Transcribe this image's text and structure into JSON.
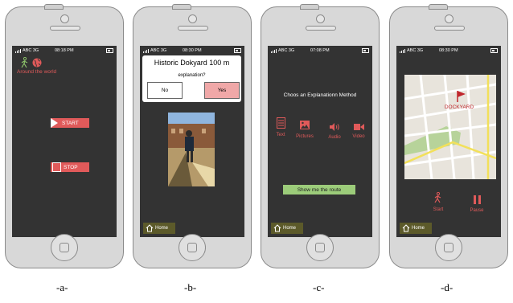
{
  "captions": [
    "-a-",
    "-b-",
    "-c-",
    "-d-"
  ],
  "status_bars": [
    {
      "carrier": "ABC 3G",
      "time": "08:18 PM"
    },
    {
      "carrier": "ABC 3G",
      "time": "08:30 PM"
    },
    {
      "carrier": "ABC 3G",
      "time": "07:08 PM"
    },
    {
      "carrier": "ABC 3G",
      "time": "08:30 PM"
    }
  ],
  "screen_a": {
    "around_label": "Around the world",
    "start_label": "START",
    "stop_label": "STOP"
  },
  "screen_b": {
    "title": "Historic Dokyard 100 m",
    "question": "explanation?",
    "no_label": "No",
    "yes_label": "Yes",
    "home_label": "Home"
  },
  "screen_c": {
    "heading": "Choos an Explanationn Method",
    "methods": [
      "Text",
      "Pictures",
      "Audio",
      "Video"
    ],
    "route_label": "Show me the route",
    "home_label": "Home"
  },
  "screen_d": {
    "map_label": "DOCKYARD",
    "start_label": "Start",
    "pause_label": "Pause",
    "home_label": "Home"
  },
  "colors": {
    "accent": "#e05a5a",
    "screen_bg": "#333333",
    "home_btn": "#5c5a2a",
    "route_btn": "#9ccc7a"
  }
}
